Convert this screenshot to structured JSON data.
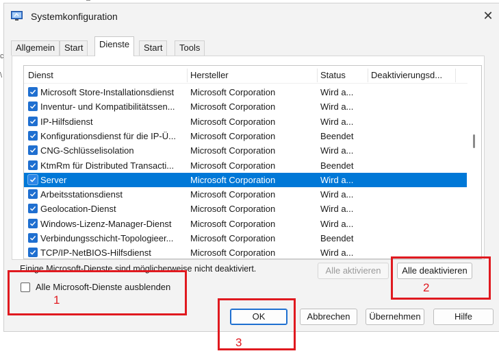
{
  "window": {
    "title": "Systemkonfiguration"
  },
  "tabs": [
    {
      "label": "Allgemein"
    },
    {
      "label": "Start"
    },
    {
      "label": "Dienste",
      "active": true
    },
    {
      "label": "Start"
    },
    {
      "label": "Tools"
    }
  ],
  "table": {
    "columns": [
      "Dienst",
      "Hersteller",
      "Status",
      "Deaktivierungsd..."
    ],
    "rows": [
      {
        "name": "Microsoft Store-Installationsdienst",
        "manufacturer": "Microsoft Corporation",
        "status": "Wird a...",
        "checked": true
      },
      {
        "name": "Inventur- und Kompatibilitätssen...",
        "manufacturer": "Microsoft Corporation",
        "status": "Wird a...",
        "checked": true
      },
      {
        "name": "IP-Hilfsdienst",
        "manufacturer": "Microsoft Corporation",
        "status": "Wird a...",
        "checked": true
      },
      {
        "name": "Konfigurationsdienst für die IP-Ü...",
        "manufacturer": "Microsoft Corporation",
        "status": "Beendet",
        "checked": true
      },
      {
        "name": "CNG-Schlüsselisolation",
        "manufacturer": "Microsoft Corporation",
        "status": "Wird a...",
        "checked": true
      },
      {
        "name": "KtmRm für Distributed Transacti...",
        "manufacturer": "Microsoft Corporation",
        "status": "Beendet",
        "checked": true
      },
      {
        "name": "Server",
        "manufacturer": "Microsoft Corporation",
        "status": "Wird a...",
        "checked": true,
        "selected": true
      },
      {
        "name": "Arbeitsstationsdienst",
        "manufacturer": "Microsoft Corporation",
        "status": "Wird a...",
        "checked": true
      },
      {
        "name": "Geolocation-Dienst",
        "manufacturer": "Microsoft Corporation",
        "status": "Wird a...",
        "checked": true
      },
      {
        "name": "Windows-Lizenz-Manager-Dienst",
        "manufacturer": "Microsoft Corporation",
        "status": "Wird a...",
        "checked": true
      },
      {
        "name": "Verbindungsschicht-Topologieer...",
        "manufacturer": "Microsoft Corporation",
        "status": "Beendet",
        "checked": true
      },
      {
        "name": "TCP/IP-NetBIOS-Hilfsdienst",
        "manufacturer": "Microsoft Corporation",
        "status": "Wird a...",
        "checked": true
      }
    ]
  },
  "note": "Einige Microsoft-Dienste sind möglicherweise nicht deaktiviert.",
  "buttons": {
    "enable_all": "Alle aktivieren",
    "disable_all": "Alle deaktivieren",
    "ok": "OK",
    "cancel": "Abbrechen",
    "apply": "Übernehmen",
    "help": "Hilfe"
  },
  "hide_ms_checkbox": {
    "label": "Alle Microsoft-Dienste ausblenden",
    "checked": false
  },
  "annotations": [
    "1",
    "2",
    "3"
  ],
  "colors": {
    "selection": "#0078d7",
    "checkbox": "#1f6fd0",
    "annotation": "#e0191f"
  }
}
